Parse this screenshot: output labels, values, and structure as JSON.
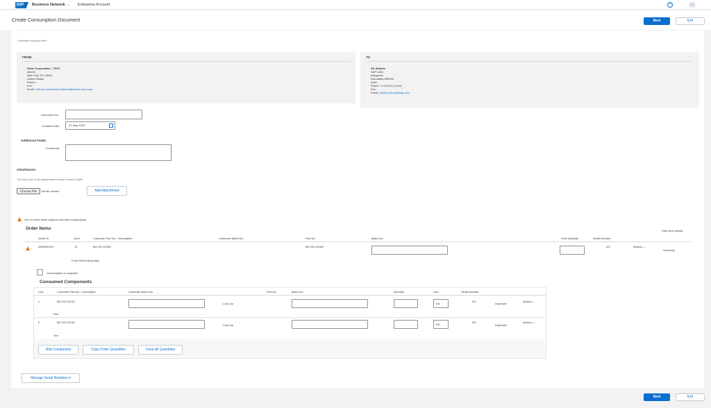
{
  "header": {
    "logo_text": "SAP",
    "brand": "Business Network",
    "brand_chevron": "⌄",
    "account": "Enterprise Account",
    "help_icon": "?",
    "user_initials": "EN"
  },
  "page": {
    "title": "Create Consumption Document",
    "next_label": "Next",
    "exit_label": "Exit",
    "required_note": "* Indicates required field"
  },
  "from": {
    "title": "FROM",
    "lines": [
      "Nube  Corporation  - TEST",
      "street1",
      "New York, NY 10001",
      "United States",
      "Phone:",
      "Fax:"
    ],
    "email_label": "Email:",
    "email": "SoE-ip.procurement.internal@demo.cloud.sap"
  },
  "to": {
    "title": "TO",
    "lines": [
      "SA Atlantic",
      "SAP LAbs",
      "Bangalore",
      "Karnataka 560036",
      "India",
      "Phone: +1 (11111) 111111",
      "Fax:"
    ],
    "email_label": "Email:",
    "email": "daniel.schunk@sap.com"
  },
  "form": {
    "doc_no_label": "Document No.:",
    "doc_no_value": "",
    "creation_date_label": "Creation Date:",
    "creation_date_value": "21 May 2024",
    "additional_fields": "Additional Fields",
    "comments_label": "Comments:",
    "comments_value": ""
  },
  "attachments": {
    "title": "Attachments",
    "note": "The total size of all attachments cannot exceed 10MB",
    "choose_file": "Choose File",
    "no_file": "No file chosen",
    "add_attachment": "Add Attachment"
  },
  "order_items": {
    "warning": "One or more items requires real-time consumption.",
    "title": "Order Items",
    "hide_details": "Hide Item Details",
    "headers": {
      "order_id": "Order ID",
      "item": "Item",
      "customer_part": "Customer Part No. / Description",
      "customer_batch": "Customer Batch No.",
      "part_no": "Part No.",
      "batch_no": "Batch No.",
      "yield_qty": "Yield Quantity",
      "serial_number": "Serial Number"
    },
    "row": {
      "order_id": "4500550401",
      "item": "10",
      "customer_part": "MZ-SG-CIG80",
      "part_no": "MZ-SG-CIG80",
      "serial": "0/0",
      "actions": "Actions ⌄",
      "summary": "Summary",
      "description": "Front Wheel Assembly",
      "consumption_complete": "Consumption is complete."
    }
  },
  "components": {
    "title": "Consumed Components",
    "headers": {
      "line": "Line",
      "customer_part": "Customer Part No. / Description",
      "customer_batch": "Customer Batch No.",
      "part_no": "Part No.",
      "batch_no": "Batch No.",
      "quantity": "Quantity",
      "unit": "Unit",
      "serial_number": "Serial Number"
    },
    "rows": [
      {
        "line": "1",
        "part": "MZ-SG-CIG15",
        "lookup": "Look Up",
        "unit": "EA",
        "serial": "0/0",
        "duplicate": "Duplicate",
        "actions": "Actions ⌄",
        "description": "Rim"
      },
      {
        "line": "2",
        "part": "MZ-SG-CIG16",
        "lookup": "Look Up",
        "unit": "EA",
        "serial": "0/0",
        "duplicate": "Duplicate",
        "actions": "Actions ⌄",
        "description": "Tire"
      }
    ],
    "add_component": "Add Component",
    "copy_quantities": "Copy Order Quantities",
    "clear_quantities": "Clear All Quantities"
  },
  "manage_serial": "Manage Serial Numbers  ▾"
}
